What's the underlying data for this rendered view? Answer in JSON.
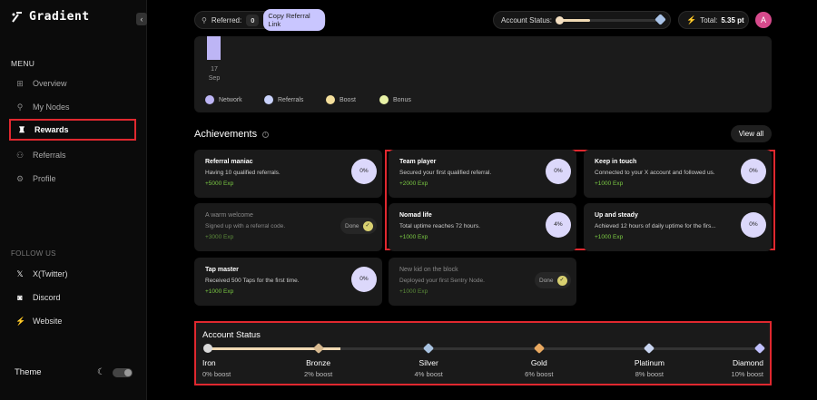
{
  "app": {
    "name": "Gradient"
  },
  "sidebar": {
    "menu_label": "MENU",
    "items": [
      {
        "label": "Overview",
        "icon": "grid-icon"
      },
      {
        "label": "My Nodes",
        "icon": "nodes-icon"
      },
      {
        "label": "Rewards",
        "icon": "rewards-icon",
        "active": true
      },
      {
        "label": "Referrals",
        "icon": "referrals-icon"
      },
      {
        "label": "Profile",
        "icon": "profile-icon"
      }
    ],
    "follow_label": "FOLLOW US",
    "social": [
      {
        "label": "X(Twitter)",
        "icon": "x-twitter-icon"
      },
      {
        "label": "Discord",
        "icon": "discord-icon"
      },
      {
        "label": "Website",
        "icon": "website-icon"
      }
    ],
    "theme_label": "Theme"
  },
  "topbar": {
    "referred_label": "Referred:",
    "referred_count": "0",
    "copy_link_label": "Copy Referral Link",
    "account_status_label": "Account Status:",
    "account_status_progress": 0.33,
    "total_label": "Total:",
    "total_value": "5.35 pt",
    "avatar_initial": "A"
  },
  "chart_data": {
    "type": "bar",
    "categories": [
      "17 Sep"
    ],
    "series": [
      {
        "name": "Network",
        "color": "#bdb5f5"
      },
      {
        "name": "Referrals",
        "color": "#c9d2fb"
      },
      {
        "name": "Boost",
        "color": "#f4df9c"
      },
      {
        "name": "Bonus",
        "color": "#e8f2a6"
      }
    ],
    "tick_day": "17",
    "tick_month": "Sep"
  },
  "achievements": {
    "title": "Achievements",
    "view_all_label": "View all",
    "cards": [
      {
        "title": "Referral maniac",
        "desc": "Having 10 qualified referrals.",
        "exp": "+5000 Exp",
        "progress": "0%",
        "done": false
      },
      {
        "title": "Team player",
        "desc": "Secured your first qualified referral.",
        "exp": "+2000 Exp",
        "progress": "0%",
        "done": false
      },
      {
        "title": "Keep in touch",
        "desc": "Connected to your X account and followed us.",
        "exp": "+1000 Exp",
        "progress": "0%",
        "done": false
      },
      {
        "title": "A warm welcome",
        "desc": "Signed up with a referral code.",
        "exp": "+3000 Exp",
        "progress": "Done",
        "done": true
      },
      {
        "title": "Nomad life",
        "desc": "Total uptime reaches 72 hours.",
        "exp": "+1000 Exp",
        "progress": "4%",
        "done": false
      },
      {
        "title": "Up and steady",
        "desc": "Achieved 12 hours of daily uptime for the firs...",
        "exp": "+1000 Exp",
        "progress": "0%",
        "done": false
      },
      {
        "title": "Tap master",
        "desc": "Received 500 Taps for the first time.",
        "exp": "+1000 Exp",
        "progress": "0%",
        "done": false
      },
      {
        "title": "New kid on the block",
        "desc": "Deployed your first Sentry Node.",
        "exp": "+1000 Exp",
        "progress": "Done",
        "done": true
      }
    ]
  },
  "account_status": {
    "title": "Account Status",
    "progress": 0.24,
    "tiers": [
      {
        "name": "Iron",
        "boost": "0% boost",
        "color": "#d9d9d9"
      },
      {
        "name": "Bronze",
        "boost": "2% boost",
        "color": "#d7b98f"
      },
      {
        "name": "Silver",
        "boost": "4% boost",
        "color": "#a8c2e0"
      },
      {
        "name": "Gold",
        "boost": "6% boost",
        "color": "#e8a860"
      },
      {
        "name": "Platinum",
        "boost": "8% boost",
        "color": "#c8d4f0"
      },
      {
        "name": "Diamond",
        "boost": "10% boost",
        "color": "#c0c0ff"
      }
    ]
  }
}
